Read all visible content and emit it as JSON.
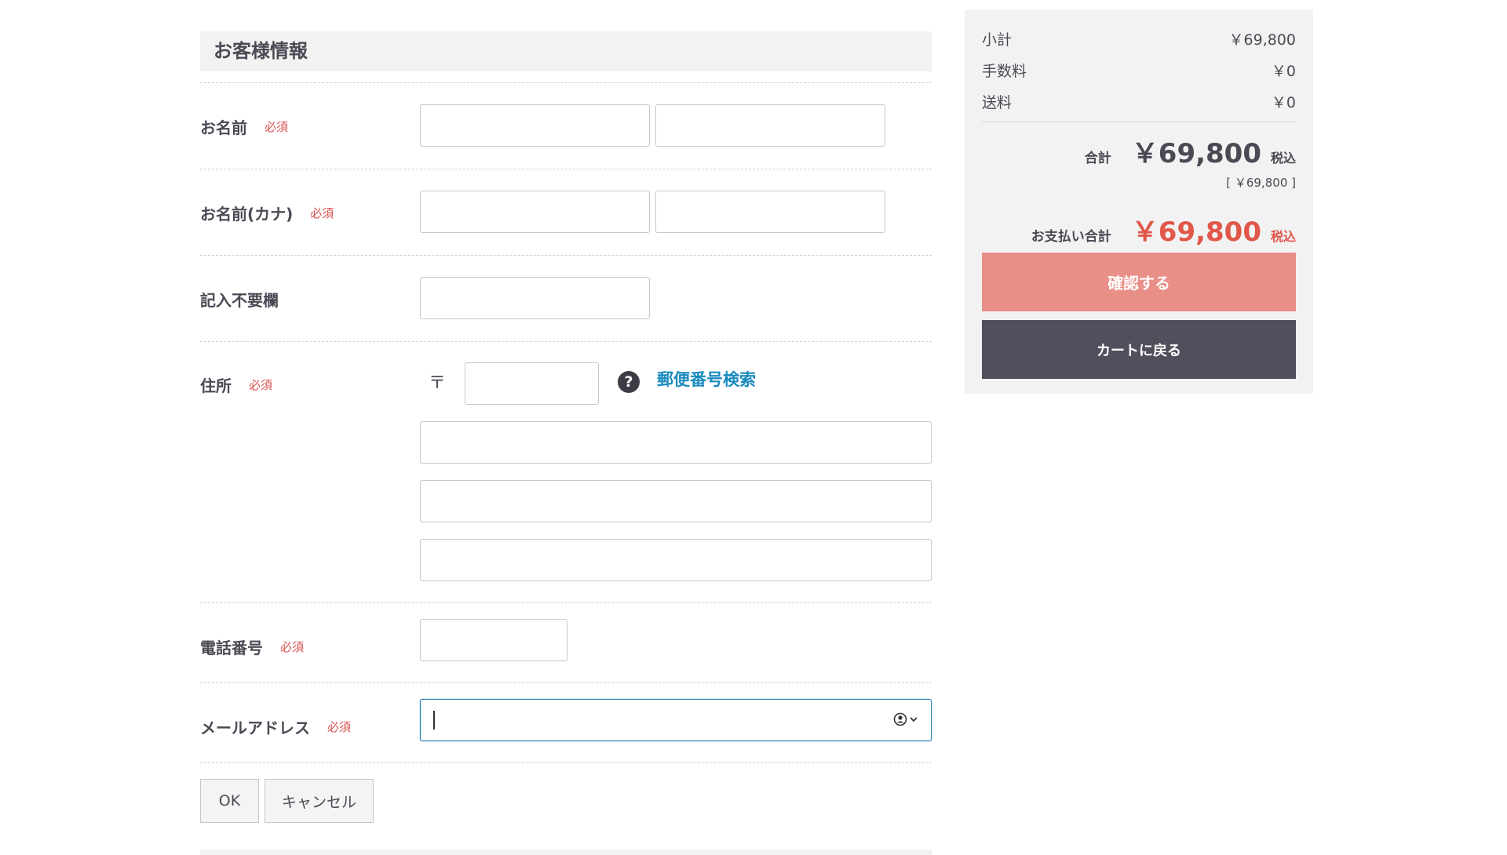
{
  "section": {
    "title": "お客様情報"
  },
  "required_label": "必須",
  "fields": {
    "name": {
      "label": "お名前",
      "last_value": "",
      "first_value": ""
    },
    "kana": {
      "label": "お名前(カナ)",
      "last_value": "",
      "first_value": ""
    },
    "unused": {
      "label": "記入不要欄",
      "value": ""
    },
    "address": {
      "label": "住所",
      "zip_mark": "〒",
      "zip_value": "",
      "zip_search_link": "郵便番号検索",
      "help_icon": "?",
      "line1_value": "",
      "line2_value": "",
      "line3_value": ""
    },
    "phone": {
      "label": "電話番号",
      "value": ""
    },
    "email": {
      "label": "メールアドレス",
      "value": ""
    }
  },
  "buttons": {
    "ok": "OK",
    "cancel": "キャンセル"
  },
  "summary": {
    "subtotal_label": "小計",
    "subtotal_value": "￥69,800",
    "fee_label": "手数料",
    "fee_value": "￥0",
    "shipping_label": "送料",
    "shipping_value": "￥0",
    "total_label": "合計",
    "total_value": "￥69,800",
    "tax_label": "税込",
    "total_sub": "[ ￥69,800 ]",
    "payment_label": "お支払い合計",
    "payment_value": "￥69,800",
    "confirm_button": "確認する",
    "back_button": "カートに戻る"
  },
  "colors": {
    "accent_red": "#e1574a",
    "confirm_button": "#e88f87",
    "back_button": "#50505c",
    "link": "#1a8bbf",
    "focus_border": "#1e7fa8"
  },
  "icons": [
    "help-icon",
    "autofill-contact-icon",
    "chevron-down-icon"
  ]
}
